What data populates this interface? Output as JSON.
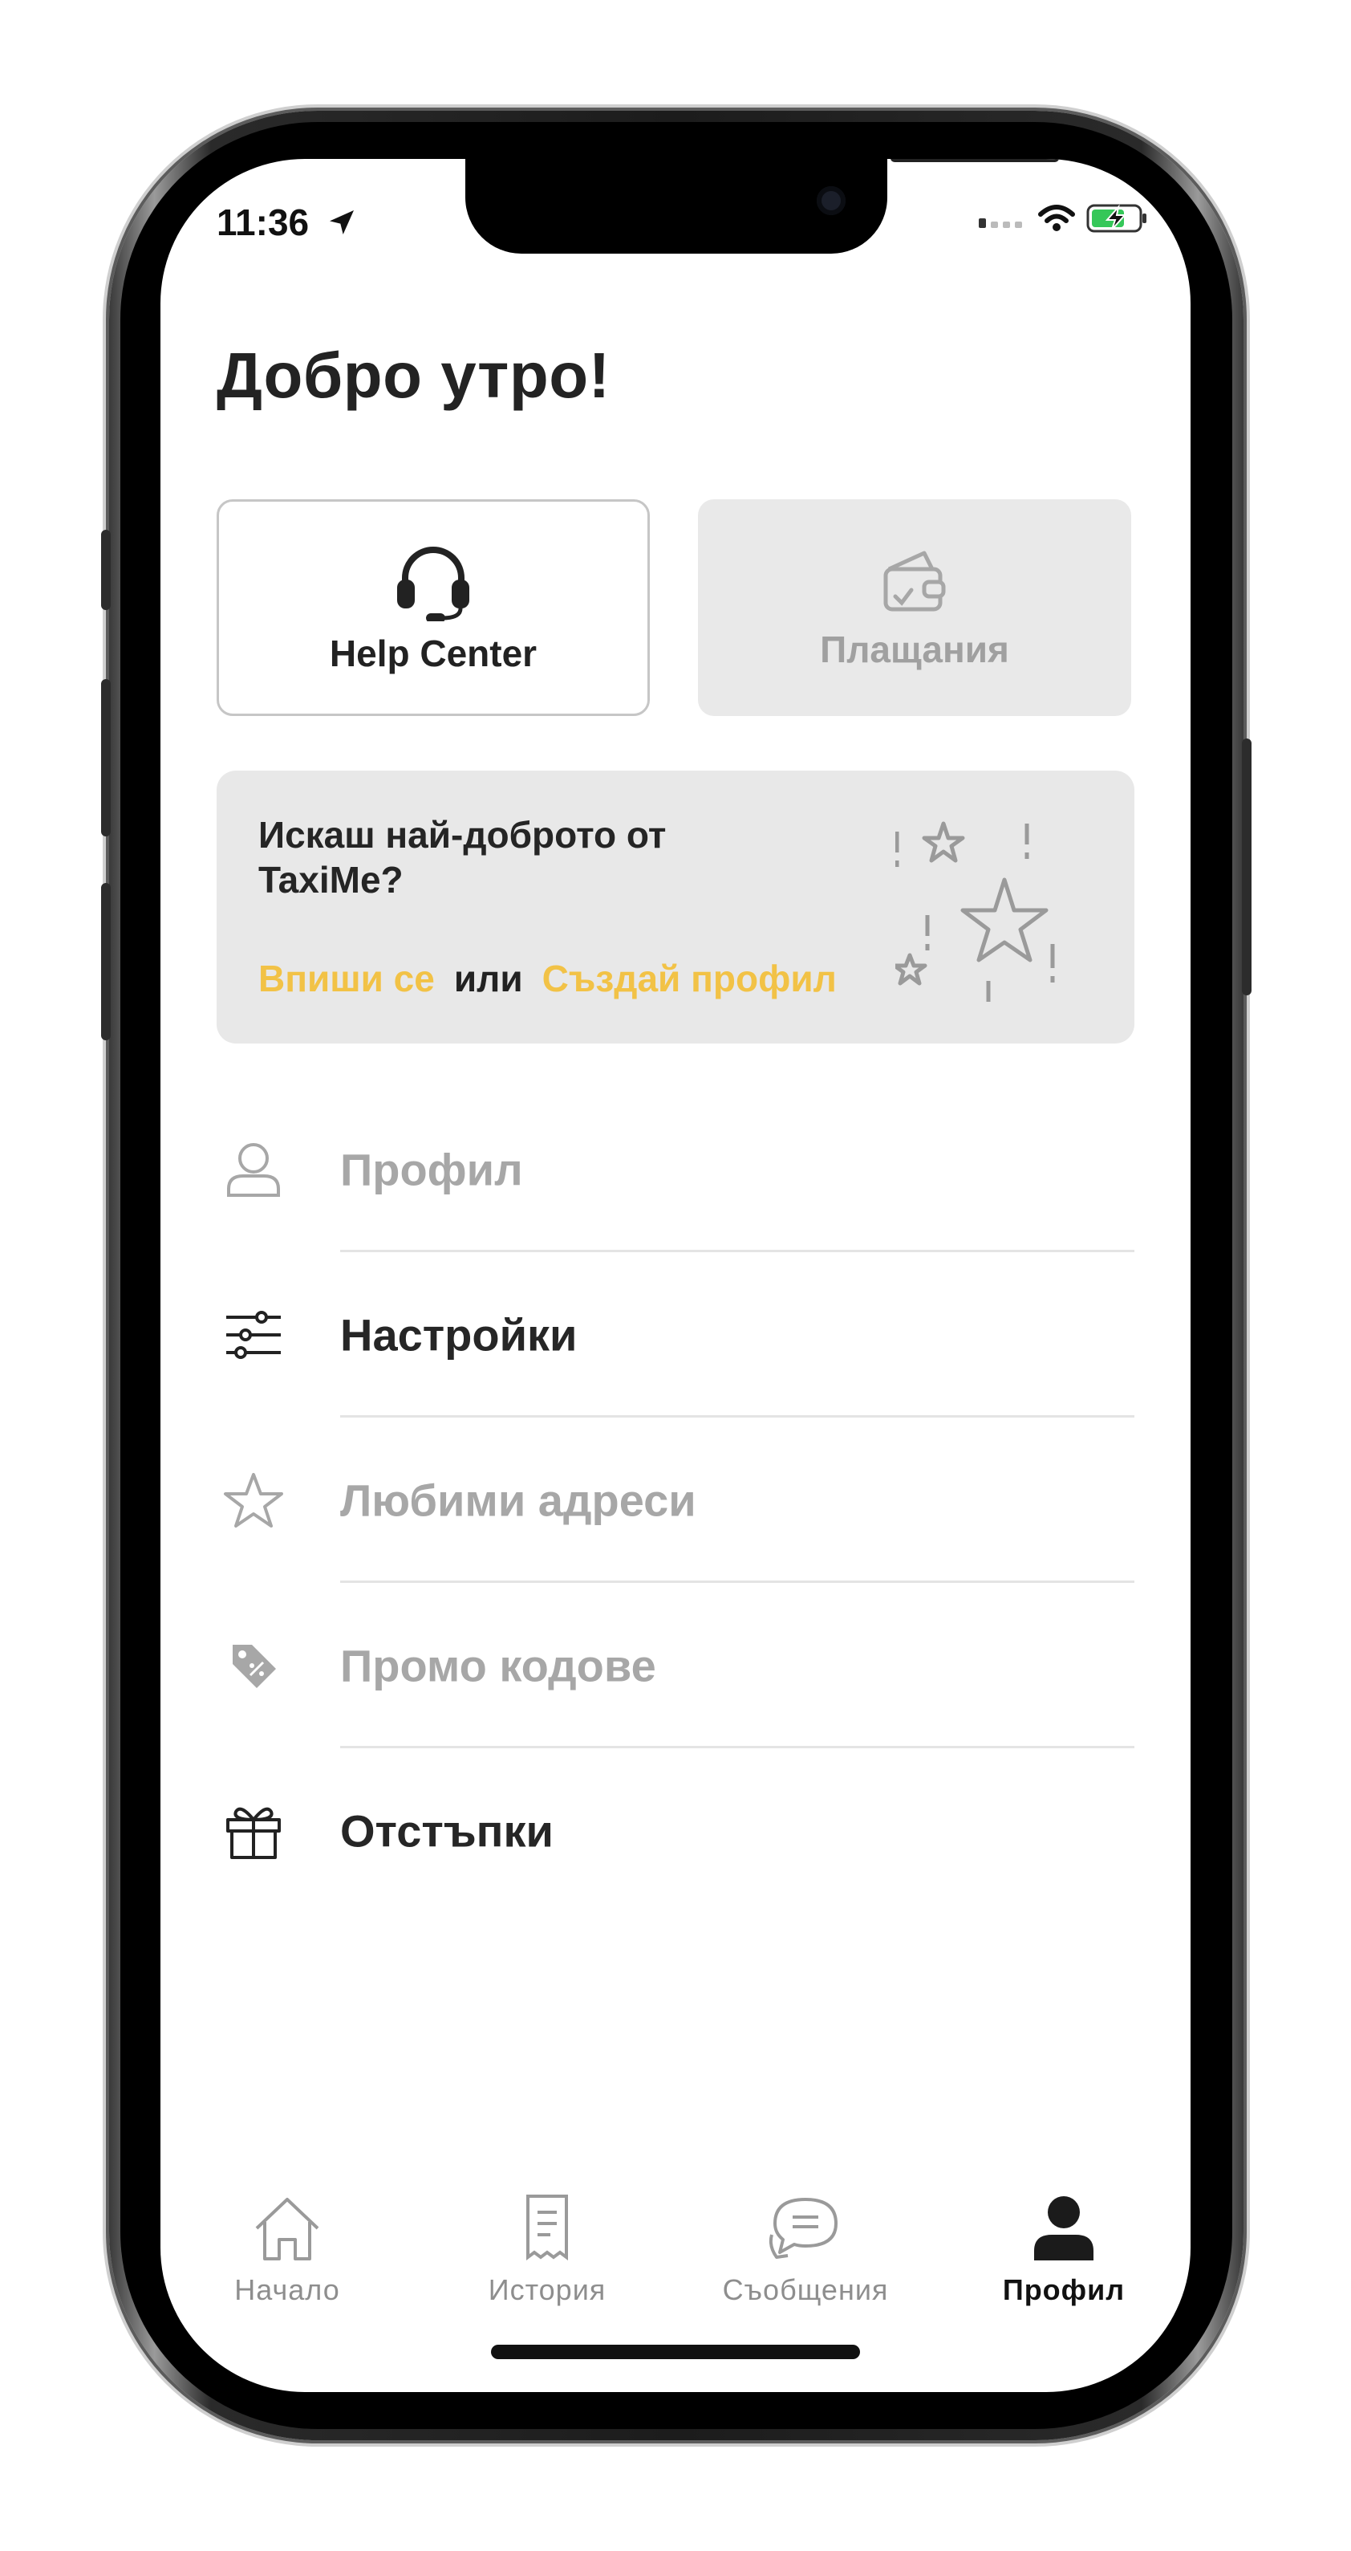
{
  "status_bar": {
    "time": "11:36"
  },
  "greeting": "Добро утро!",
  "tiles": {
    "help_center": "Help Center",
    "payments": "Плащания"
  },
  "promo": {
    "title": "Искаш най-доброто от TaxiMe?",
    "login_link": "Впиши се",
    "or_text": "или",
    "signup_link": "Създай профил"
  },
  "menu": {
    "items": [
      {
        "label": "Профил",
        "icon": "person-icon",
        "enabled": false
      },
      {
        "label": "Настройки",
        "icon": "sliders-icon",
        "enabled": true
      },
      {
        "label": "Любими адреси",
        "icon": "star-icon",
        "enabled": false
      },
      {
        "label": "Промо кодове",
        "icon": "tag-icon",
        "enabled": false
      },
      {
        "label": "Отстъпки",
        "icon": "gift-icon",
        "enabled": true
      }
    ]
  },
  "tabbar": {
    "tabs": [
      {
        "label": "Начало",
        "icon": "home-icon"
      },
      {
        "label": "История",
        "icon": "receipt-icon"
      },
      {
        "label": "Съобщения",
        "icon": "chat-icon"
      },
      {
        "label": "Профил",
        "icon": "person-filled-icon",
        "active": true
      }
    ]
  },
  "colors": {
    "accent": "#f2c246",
    "text_dark": "#232323",
    "text_disabled": "#a7a7a7",
    "card_bg": "#e8e8e8"
  }
}
